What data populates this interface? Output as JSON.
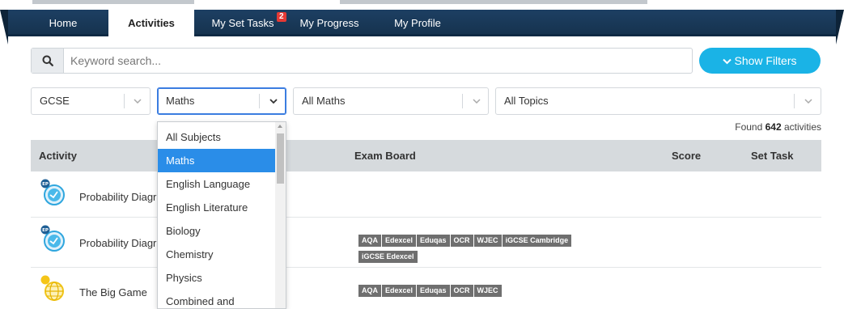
{
  "nav": {
    "tabs": [
      {
        "label": "Home"
      },
      {
        "label": "Activities"
      },
      {
        "label": "My Set Tasks",
        "badge": "2"
      },
      {
        "label": "My Progress"
      },
      {
        "label": "My Profile"
      }
    ],
    "active": "Activities"
  },
  "search": {
    "placeholder": "Keyword search...",
    "icon": "search-icon"
  },
  "filters_button": {
    "label": "Show Filters",
    "icon": "chevron-down-icon"
  },
  "selects": {
    "level": "GCSE",
    "subject": "Maths",
    "course": "All Maths",
    "topics": "All Topics"
  },
  "found": {
    "prefix": "Found",
    "count": "642",
    "suffix": "activities"
  },
  "table": {
    "headers": {
      "activity": "Activity",
      "exam_board": "Exam Board",
      "score": "Score",
      "set_task": "Set Task"
    },
    "rows": [
      {
        "title": "Probability Diagrams",
        "boards": []
      },
      {
        "title": "Probability Diagrams",
        "boards": [
          "AQA",
          "Edexcel",
          "Eduqas",
          "OCR",
          "WJEC",
          "iGCSE Cambridge",
          "iGCSE Edexcel"
        ]
      },
      {
        "title": "The Big Game",
        "boards": [
          "AQA",
          "Edexcel",
          "Eduqas",
          "OCR",
          "WJEC"
        ]
      }
    ]
  },
  "dropdown": {
    "options": [
      "All Subjects",
      "Maths",
      "English Language",
      "English Literature",
      "Biology",
      "Chemistry",
      "Physics",
      "Combined and"
    ],
    "selected": "Maths"
  },
  "colors": {
    "nav_bg": "#1d3f63",
    "accent": "#1ab3e6",
    "selected": "#2a8de8",
    "badge": "#e53935",
    "header_bg": "#d6dadd"
  }
}
